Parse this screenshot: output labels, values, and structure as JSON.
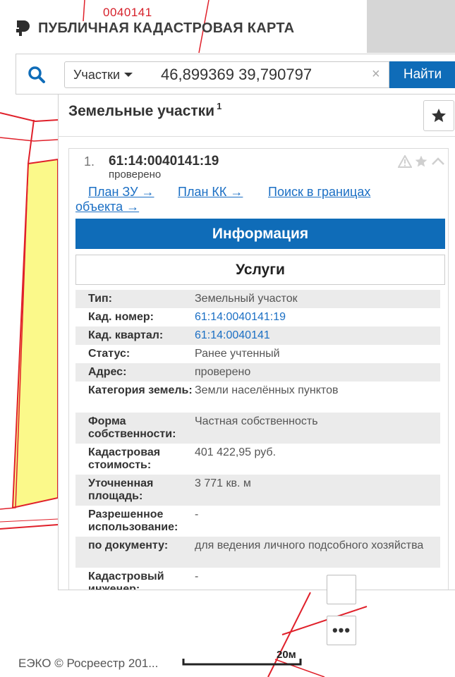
{
  "map": {
    "parcel_label": "0040141",
    "copyright": "ЕЭКО © Росреестр 201...",
    "scale_label": "20м",
    "more_label": "•••"
  },
  "header": {
    "title": "ПУБЛИЧНАЯ КАДАСТРОВАЯ КАРТА",
    "logo_icon": "rosreestr-logo-icon"
  },
  "search": {
    "category": "Участки",
    "query": "46,899369 39,790797",
    "clear_label": "×",
    "find_label": "Найти"
  },
  "panel": {
    "title": "Земельные участки",
    "count": "1",
    "card": {
      "index": "1.",
      "cad_number": "61:14:0040141:19",
      "status": "проверено",
      "links": {
        "plan_zu": "План ЗУ →",
        "plan_kk": "План КК →",
        "search_bounds_1": "Поиск в границах",
        "search_bounds_2": "объекта →"
      },
      "info_label": "Информация",
      "services_label": "Услуги",
      "rows": [
        {
          "key": "Тип:",
          "value": "Земельный участок"
        },
        {
          "key": "Кад. номер:",
          "value": "61:14:0040141:19"
        },
        {
          "key": "Кад. квартал:",
          "value": "61:14:0040141"
        },
        {
          "key": "Статус:",
          "value": "Ранее учтенный"
        },
        {
          "key": "Адрес:",
          "value": "проверено"
        },
        {
          "key": "Категория земель:",
          "value": "Земли населённых пунктов"
        },
        {
          "key": "Форма собственности:",
          "value": "Частная собственность"
        },
        {
          "key": "Кадастровая стоимость:",
          "value": "401 422,95 руб."
        },
        {
          "key": "Уточненная площадь:",
          "value": "3 771 кв. м"
        },
        {
          "key": "Разрешенное использование:",
          "value": "-"
        },
        {
          "key": "по документу:",
          "value": "для ведения личного подсобного хозяйства"
        },
        {
          "key": "Кадастровый инженер:",
          "value": "-"
        }
      ]
    }
  },
  "colors": {
    "accent": "#0f6cb8",
    "link": "#1b6fc4",
    "parcel_line": "#e0202a",
    "parcel_fill": "#fbf98a"
  }
}
